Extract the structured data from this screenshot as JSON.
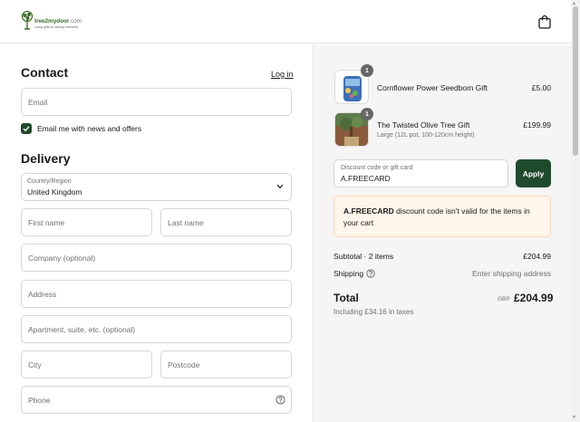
{
  "header": {
    "logo_name_brand": "tree2mydoor",
    "logo_name_suffix": ".com",
    "logo_tagline": "Living gifts for lasting moments"
  },
  "contact": {
    "heading": "Contact",
    "login_link": "Log in",
    "email_placeholder": "Email",
    "newsletter_label": "Email me with news and offers",
    "newsletter_checked": true
  },
  "delivery": {
    "heading": "Delivery",
    "country_label": "Country/Region",
    "country_value": "United Kingdom",
    "first_name_placeholder": "First name",
    "last_name_placeholder": "Last name",
    "company_placeholder": "Company (optional)",
    "address_placeholder": "Address",
    "apartment_placeholder": "Apartment, suite, etc. (optional)",
    "city_placeholder": "City",
    "postcode_placeholder": "Postcode",
    "phone_placeholder": "Phone"
  },
  "cart": {
    "items": [
      {
        "name": "Cornflower Power Seedbom Gift",
        "variant": "",
        "price": "£5.00",
        "quantity": "1"
      },
      {
        "name": "The Twisted Olive Tree Gift",
        "variant": "Large (12L pot, 100-120cm height)",
        "price": "£199.99",
        "quantity": "1"
      }
    ],
    "discount_label": "Discount code or gift card",
    "discount_value": "A.FREECARD",
    "apply_label": "Apply",
    "error_code": "A.FREECARD",
    "error_message": " discount code isn't valid for the items in your cart",
    "subtotal_label": "Subtotal · 2 items",
    "subtotal_value": "£204.99",
    "shipping_label": "Shipping",
    "shipping_value": "Enter shipping address",
    "total_label": "Total",
    "total_currency": "GBP",
    "total_value": "£204.99",
    "tax_line": "Including £34.16 in taxes"
  },
  "colors": {
    "accent": "#1f4a2c",
    "brand_green": "#3a6e25",
    "error_bg": "#fff5ea",
    "summary_bg": "#f5f5f5"
  }
}
